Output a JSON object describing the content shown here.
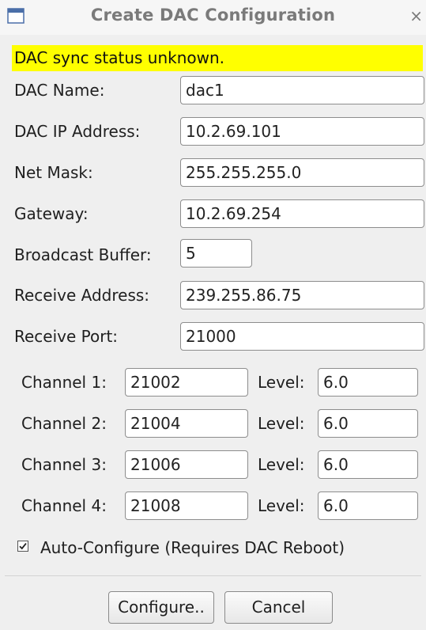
{
  "window": {
    "title": "Create DAC Configuration",
    "close": "×"
  },
  "status": "DAC sync status unknown.",
  "form": {
    "dac_name": {
      "label": "DAC Name:",
      "value": "dac1"
    },
    "ip": {
      "label": "DAC IP Address:",
      "value": "10.2.69.101"
    },
    "netmask": {
      "label": "Net Mask:",
      "value": "255.255.255.0"
    },
    "gateway": {
      "label": "Gateway:",
      "value": "10.2.69.254"
    },
    "bcast": {
      "label": "Broadcast Buffer:",
      "value": "5"
    },
    "recv_addr": {
      "label": "Receive Address:",
      "value": "239.255.86.75"
    },
    "recv_port": {
      "label": "Receive Port:",
      "value": "21000"
    }
  },
  "channels": [
    {
      "label": "Channel 1:",
      "port": "21002",
      "level_label": "Level:",
      "level": "6.0"
    },
    {
      "label": "Channel 2:",
      "port": "21004",
      "level_label": "Level:",
      "level": "6.0"
    },
    {
      "label": "Channel 3:",
      "port": "21006",
      "level_label": "Level:",
      "level": "6.0"
    },
    {
      "label": "Channel 4:",
      "port": "21008",
      "level_label": "Level:",
      "level": "6.0"
    }
  ],
  "auto_configure": {
    "label": "Auto-Configure (Requires DAC Reboot)",
    "checked": true
  },
  "buttons": {
    "configure": "Configure..",
    "cancel": "Cancel"
  }
}
